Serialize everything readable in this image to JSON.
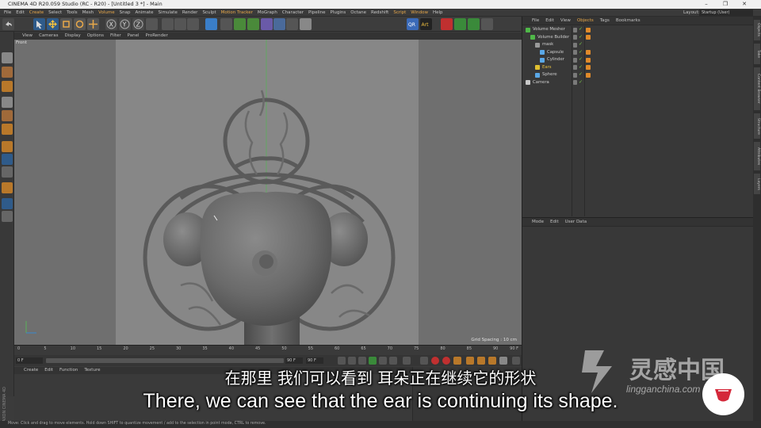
{
  "titlebar": {
    "title": "CINEMA 4D R20.059 Studio (RC - R20) - [Untitled 3 *] - Main",
    "minimize": "–",
    "maximize": "❐",
    "close": "✕"
  },
  "menubar": {
    "items": [
      "File",
      "Edit",
      "Create",
      "Select",
      "Tools",
      "Mesh",
      "Volume",
      "Snap",
      "Animate",
      "Simulate",
      "Render",
      "Sculpt",
      "Motion Tracker",
      "MoGraph",
      "Character",
      "Pipeline",
      "Plugins",
      "Octane",
      "Redshift",
      "Script",
      "Window",
      "Help"
    ],
    "layout_label": "Layout:",
    "layout_value": "Startup (User)"
  },
  "viewport": {
    "menu": [
      "View",
      "Cameras",
      "Display",
      "Options",
      "Filter",
      "Panel",
      "ProRender"
    ],
    "camera_label": "Front",
    "grid_spacing": "Grid Spacing : 10 cm"
  },
  "timeline": {
    "ticks": [
      "0",
      "5",
      "10",
      "15",
      "20",
      "25",
      "30",
      "35",
      "40",
      "45",
      "50",
      "55",
      "60",
      "65",
      "70",
      "75",
      "80",
      "85",
      "90"
    ],
    "frame_end": "90 F",
    "start_field": "0 F",
    "end_field": "90 F",
    "end_field2": "90 F"
  },
  "material_manager": {
    "menu": [
      "Create",
      "Edit",
      "Function",
      "Texture"
    ]
  },
  "object_manager": {
    "menu": [
      "File",
      "Edit",
      "View",
      "Objects",
      "Tags",
      "Bookmarks"
    ],
    "objects": [
      {
        "name": "Volume Mesher",
        "indent": 0,
        "color": "#4fb848"
      },
      {
        "name": "Volume Builder",
        "indent": 1,
        "color": "#4fb848"
      },
      {
        "name": "mask",
        "indent": 2,
        "color": "#9a9a9a"
      },
      {
        "name": "Capsule",
        "indent": 3,
        "color": "#5aa8e8"
      },
      {
        "name": "Cylinder",
        "indent": 3,
        "color": "#5aa8e8"
      },
      {
        "name": "Ears",
        "indent": 2,
        "color": "#e0c030",
        "highlight": true
      },
      {
        "name": "Sphere",
        "indent": 2,
        "color": "#5aa8e8"
      },
      {
        "name": "Camera",
        "indent": 0,
        "color": "#c8c8c8"
      }
    ]
  },
  "attribute_manager": {
    "menu": [
      "Mode",
      "Edit",
      "User Data"
    ]
  },
  "right_tabs": [
    "Objects",
    "Take",
    "Content Browser",
    "Structure",
    "Attributes",
    "Layers"
  ],
  "statusbar": {
    "text": "Move: Click and drag to move elements. Hold down SHIFT to quantize movement / add to the selection in point mode, CTRL to remove."
  },
  "side_logo": "MAXON CINEMA 4D",
  "subtitles": {
    "chinese": "在那里 我们可以看到 耳朵正在继续它的形状",
    "english": "There, we can see that the ear is continuing its shape."
  },
  "watermark": {
    "text": "灵感中国",
    "url": "lingganchina.com"
  },
  "colors": {
    "accent": "#e8a84a",
    "green": "#4fb848",
    "viewport_bg": "#878787"
  }
}
